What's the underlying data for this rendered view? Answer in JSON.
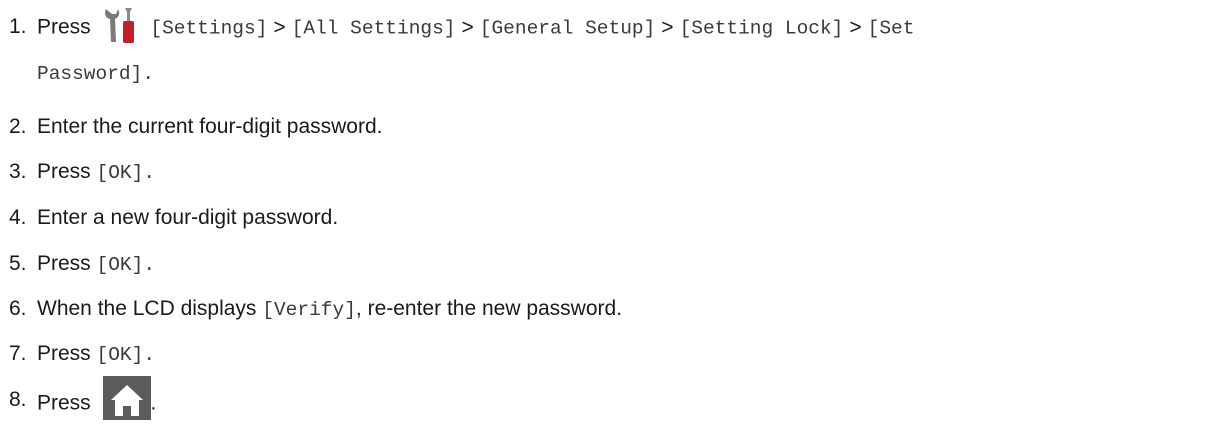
{
  "steps": [
    {
      "num": "1.",
      "prefix": "Press",
      "icon": "settings-icon",
      "path": [
        "[Settings]",
        "[All Settings]",
        "[General Setup]",
        "[Setting Lock]",
        "[Set"
      ],
      "path_cont": "Password].",
      "separator": ">"
    },
    {
      "num": "2.",
      "text": "Enter the current four-digit password."
    },
    {
      "num": "3.",
      "prefix": "Press",
      "code": "[OK].",
      "suffix": ""
    },
    {
      "num": "4.",
      "text": "Enter a new four-digit password."
    },
    {
      "num": "5.",
      "prefix": "Press",
      "code": "[OK].",
      "suffix": ""
    },
    {
      "num": "6.",
      "prefix": "When the LCD displays",
      "code": "[Verify]",
      "suffix": ", re-enter the new password."
    },
    {
      "num": "7.",
      "prefix": "Press",
      "code": "[OK].",
      "suffix": ""
    },
    {
      "num": "8.",
      "prefix": "Press",
      "icon": "home-icon",
      "suffix": "."
    }
  ],
  "colors": {
    "text": "#1a1a1a",
    "code": "#3a3a3a",
    "icon_gray": "#7a7a7a",
    "icon_red": "#c0202a",
    "home_bg": "#5b5b5b"
  }
}
